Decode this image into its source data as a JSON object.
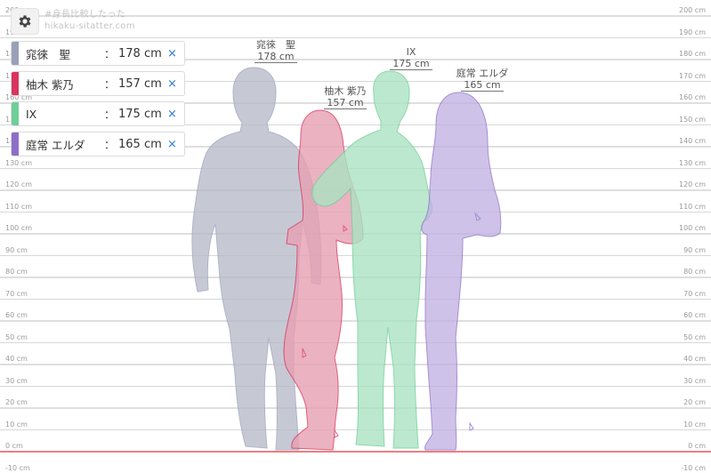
{
  "brand": {
    "line1": "#身長比較したった",
    "line2": "hikaku-sitatter.com"
  },
  "settings_icon": "gear-icon",
  "scale": {
    "ticks": [
      "-10 cm",
      "0 cm",
      "10 cm",
      "20 cm",
      "30 cm",
      "40 cm",
      "50 cm",
      "60 cm",
      "70 cm",
      "80 cm",
      "90 cm",
      "100 cm",
      "110 cm",
      "120 cm",
      "130 cm",
      "140 cm",
      "150 cm",
      "160 cm",
      "170 cm",
      "180 cm",
      "190 cm",
      "200 cm"
    ]
  },
  "people": [
    {
      "name": "窕徠　聖",
      "height": "178 cm",
      "height_cm": 178,
      "color": "#9aa0b8",
      "fill": "#b9bccb",
      "remove": "×"
    },
    {
      "name": "柚木 紫乃",
      "height": "157 cm",
      "height_cm": 157,
      "color": "#d8345f",
      "fill": "#e393a6",
      "remove": "×"
    },
    {
      "name": "IX",
      "height": "175 cm",
      "height_cm": 175,
      "color": "#6fcf97",
      "fill": "#a8e0bf",
      "remove": "×"
    },
    {
      "name": "庭常 エルダ",
      "height": "165 cm",
      "height_cm": 165,
      "color": "#8e6fc8",
      "fill": "#bca8dd",
      "remove": "×"
    }
  ],
  "colon": "：",
  "bottom_mark": "0 cm"
}
